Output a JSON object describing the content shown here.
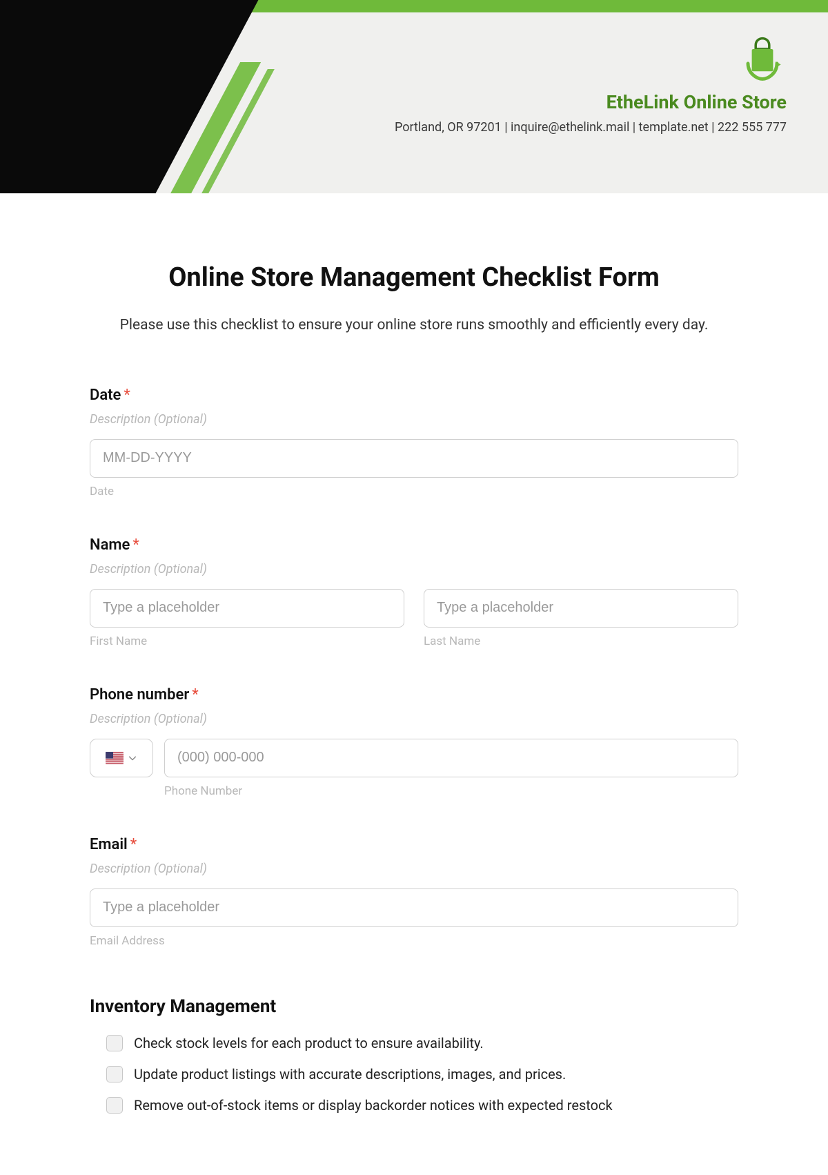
{
  "header": {
    "store_name": "EtheLink Online Store",
    "info_line": "Portland, OR 97201 | inquire@ethelink.mail | template.net | 222 555 777"
  },
  "form": {
    "title": "Online Store Management Checklist Form",
    "subtitle": "Please use this checklist to ensure your online store runs smoothly and efficiently every day."
  },
  "fields": {
    "date": {
      "label": "Date",
      "desc": "Description (Optional)",
      "placeholder": "MM-DD-YYYY",
      "sub": "Date"
    },
    "name": {
      "label": "Name",
      "desc": "Description (Optional)",
      "first_placeholder": "Type a placeholder",
      "last_placeholder": "Type a placeholder",
      "first_sub": "First Name",
      "last_sub": "Last Name"
    },
    "phone": {
      "label": "Phone number",
      "desc": "Description (Optional)",
      "placeholder": "(000) 000-000",
      "sub": "Phone Number"
    },
    "email": {
      "label": "Email",
      "desc": "Description (Optional)",
      "placeholder": "Type a placeholder",
      "sub": "Email Address"
    }
  },
  "inventory": {
    "heading": "Inventory Management",
    "items": [
      "Check stock levels for each product to ensure availability.",
      "Update product listings with accurate descriptions, images, and prices.",
      "Remove out-of-stock items or display backorder notices with expected restock"
    ]
  },
  "colors": {
    "brand_green": "#6fba3a",
    "brand_dark_green": "#4a8a1f"
  }
}
